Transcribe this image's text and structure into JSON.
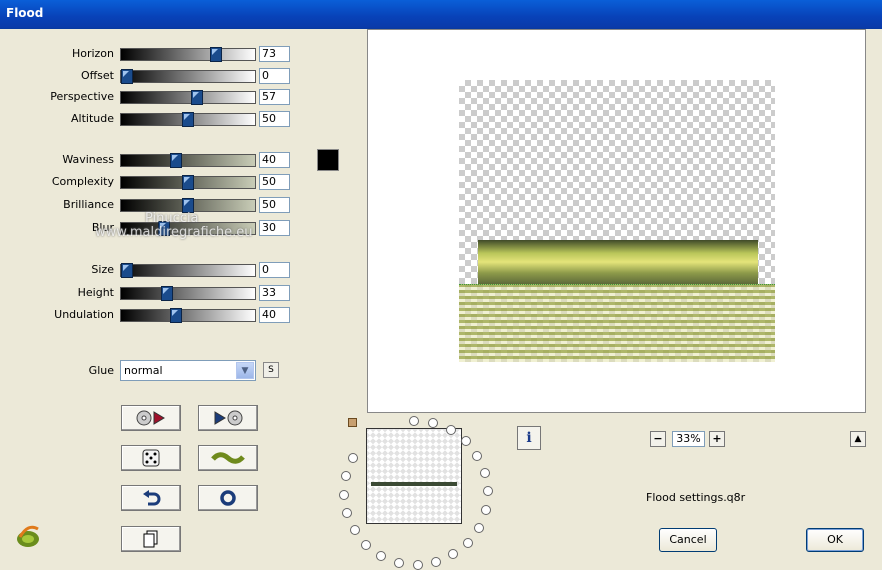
{
  "window": {
    "title": "Flood"
  },
  "sliders": [
    {
      "label": "Horizon",
      "value": "73"
    },
    {
      "label": "Offset",
      "value": "0"
    },
    {
      "label": "Perspective",
      "value": "57"
    },
    {
      "label": "Altitude",
      "value": "50"
    },
    {
      "label": "Waviness",
      "value": "40"
    },
    {
      "label": "Complexity",
      "value": "50"
    },
    {
      "label": "Brilliance",
      "value": "50"
    },
    {
      "label": "Blur",
      "value": "30"
    },
    {
      "label": "Size",
      "value": "0"
    },
    {
      "label": "Height",
      "value": "33"
    },
    {
      "label": "Undulation",
      "value": "40"
    }
  ],
  "slider_fractions": [
    0.73,
    0.0,
    0.57,
    0.5,
    0.4,
    0.5,
    0.5,
    0.3,
    0.0,
    0.33,
    0.4
  ],
  "color_swatch": "#000000",
  "glue": {
    "label": "Glue",
    "value": "normal",
    "s_button": "S"
  },
  "watermark": {
    "line1": "Pinuccia",
    "line2": "www.maldiregrafiche.eu"
  },
  "zoom": {
    "value": "33%",
    "minus": "−",
    "plus": "+"
  },
  "settings_file": "Flood settings.q8r",
  "buttons": {
    "cancel": "Cancel",
    "ok": "OK"
  },
  "colors": {
    "title_bar": "#0842b8",
    "dialog": "#ece9d8",
    "thumb": "#1a4b8c"
  }
}
